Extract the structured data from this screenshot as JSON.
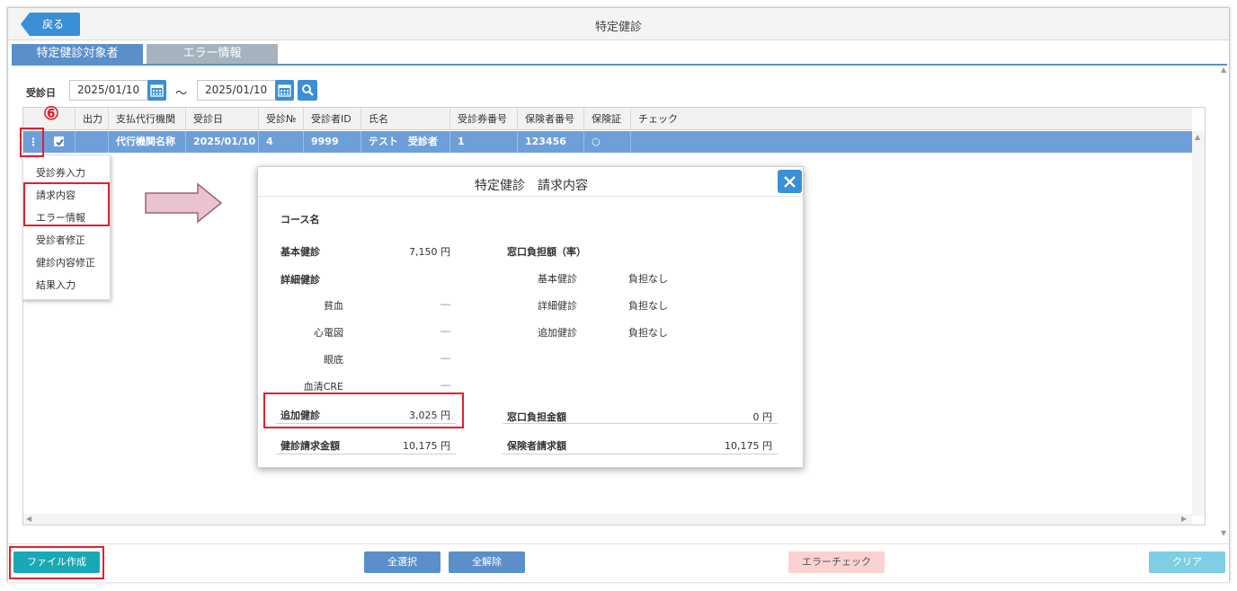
{
  "header": {
    "back_label": "戻る",
    "title": "特定健診"
  },
  "tabs": [
    {
      "label": "特定健診対象者"
    },
    {
      "label": "エラー情報"
    }
  ],
  "filter": {
    "label": "受診日",
    "date_from": "2025/01/10",
    "separator": "～",
    "date_to": "2025/01/10"
  },
  "grid": {
    "columns": [
      "出力",
      "支払代行機関",
      "受診日",
      "受診№",
      "受診者ID",
      "氏名",
      "受診券番号",
      "保険者番号",
      "保険証",
      "チェック"
    ],
    "rows": [
      {
        "menu": "⋮",
        "checked": true,
        "cells": [
          "",
          "代行機関名称",
          "2025/01/10",
          "4",
          "9999",
          "テスト　受診者",
          "1",
          "123456",
          "○",
          ""
        ]
      }
    ]
  },
  "annotation": {
    "step": "⑥"
  },
  "context_menu": {
    "items": [
      "受診券入力",
      "請求内容",
      "エラー情報",
      "受診者修正",
      "健診内容修正",
      "結果入力"
    ]
  },
  "modal": {
    "title": "特定健診　請求内容",
    "course_label": "コース名",
    "basic_label": "基本健診",
    "basic_value": "7,150 円",
    "detail_label": "詳細健診",
    "detail_items": [
      {
        "label": "貧血",
        "value": "―"
      },
      {
        "label": "心電図",
        "value": "―"
      },
      {
        "label": "眼底",
        "value": "―"
      },
      {
        "label": "血清CRE",
        "value": "―"
      }
    ],
    "additional_label": "追加健診",
    "additional_value": "3,025 円",
    "total_label": "健診請求金額",
    "total_value": "10,175 円",
    "copay_rate_label": "窓口負担額（率）",
    "copay_items": [
      {
        "label": "基本健診",
        "value": "負担なし"
      },
      {
        "label": "詳細健診",
        "value": "負担なし"
      },
      {
        "label": "追加健診",
        "value": "負担なし"
      }
    ],
    "copay_amount_label": "窓口負担金額",
    "copay_amount_value": "0 円",
    "insurer_label": "保険者請求額",
    "insurer_value": "10,175 円"
  },
  "footer": {
    "create_file": "ファイル作成",
    "select_all": "全選択",
    "deselect_all": "全解除",
    "error_check": "エラーチェック",
    "clear": "クリア"
  },
  "colors": {
    "primary": "#3a8fd6",
    "row_selected": "#6f9fd8",
    "teal": "#17a9b6",
    "highlight_red": "#e0202c",
    "pink_button": "#fbd2d2",
    "clear_button": "#7ecfe3"
  }
}
